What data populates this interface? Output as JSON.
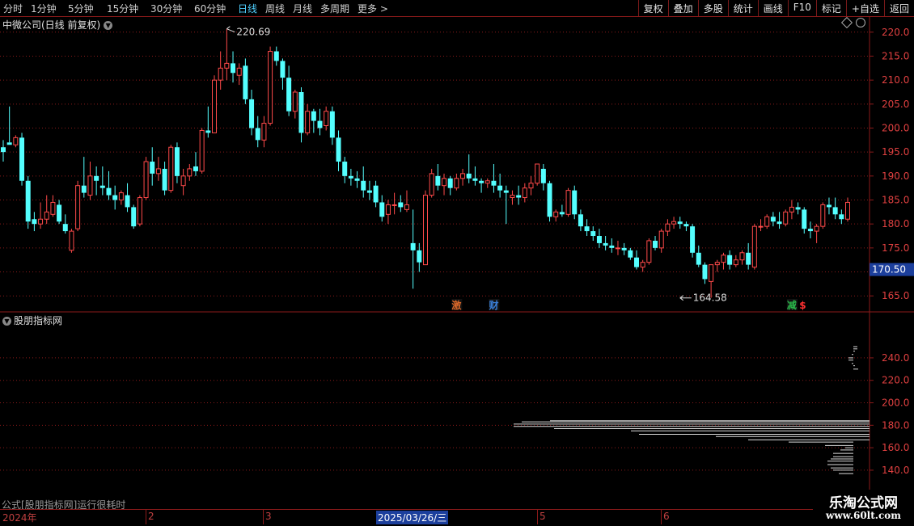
{
  "toolbar": {
    "left_items": [
      "分时",
      "1分钟",
      "5分钟",
      "15分钟",
      "30分钟",
      "60分钟",
      "日线",
      "周线",
      "月线",
      "多周期",
      "更多 >"
    ],
    "active_item": "日线",
    "right_items": [
      "复权",
      "叠加",
      "多股",
      "统计",
      "画线",
      "F10",
      "标记",
      "+自选",
      "返回"
    ]
  },
  "main_pane": {
    "title": "中微公司(日线 前复权)",
    "circle_icon": "chevron-down-icon"
  },
  "indicator_pane": {
    "title": "股朋指标网"
  },
  "status_message": "公式[股朋指标网]运行很耗时",
  "timeline": {
    "labels": [
      "2024年",
      "2",
      "3",
      "5",
      "6"
    ],
    "selected_date": "2025/03/26/三"
  },
  "watermark": {
    "title": "乐淘公式网",
    "url": "www.60lt.com"
  },
  "colors": {
    "up": "#ff4a4a",
    "down": "#54ffff",
    "grid": "#8b1a1a",
    "axis_text": "#e04040",
    "price_box": "#1c3f9c"
  },
  "chart_data": [
    {
      "type": "candlestick",
      "ylim": [
        162,
        223
      ],
      "yticks": [
        "220.0",
        "215.0",
        "210.0",
        "205.0",
        "200.0",
        "195.0",
        "190.0",
        "185.0",
        "180.0",
        "175.0",
        "170.0",
        "165.0"
      ],
      "ytick_values": [
        220,
        215,
        210,
        205,
        200,
        195,
        190,
        185,
        180,
        175,
        170,
        165
      ],
      "annotations": {
        "high": {
          "label": "220.69",
          "value": 220.69,
          "index": 36
        },
        "low": {
          "label": "164.58",
          "value": 164.58,
          "index": 109
        },
        "current_price": {
          "label": "170.50",
          "value": 170.5
        }
      },
      "markers": [
        {
          "label": "激",
          "index": 73,
          "color": "#e06a2a"
        },
        {
          "label": "财",
          "index": 79,
          "color": "#3a7fd8"
        },
        {
          "label": "减",
          "index": 127,
          "color": "#2ab84a"
        },
        {
          "label": "$",
          "index": 129,
          "color": "#ff3030"
        }
      ],
      "candles": [
        [
          196.0,
          197.5,
          195.0,
          193.0
        ],
        [
          197.0,
          204.5,
          196.5,
          197.0
        ],
        [
          196.5,
          198.5,
          198.0,
          196.0
        ],
        [
          198.0,
          199.0,
          189.0,
          188.0
        ],
        [
          189.0,
          190.0,
          180.5,
          179.0
        ],
        [
          181.0,
          182.5,
          180.0,
          178.5
        ],
        [
          180.0,
          184.5,
          181.0,
          179.0
        ],
        [
          181.0,
          186.0,
          182.5,
          180.0
        ],
        [
          182.0,
          186.0,
          184.5,
          181.5
        ],
        [
          184.0,
          185.0,
          180.5,
          180.0
        ],
        [
          180.0,
          182.0,
          178.5,
          178.0
        ],
        [
          174.5,
          179.0,
          178.5,
          174.0
        ],
        [
          179.0,
          189.0,
          188.0,
          178.5
        ],
        [
          188.0,
          194.0,
          186.5,
          185.5
        ],
        [
          186.0,
          193.0,
          190.0,
          185.0
        ],
        [
          190.0,
          192.0,
          189.0,
          186.0
        ],
        [
          188.0,
          192.0,
          187.5,
          186.0
        ],
        [
          187.5,
          191.0,
          186.0,
          185.0
        ],
        [
          186.0,
          188.0,
          185.0,
          183.0
        ],
        [
          185.0,
          187.0,
          186.5,
          184.0
        ],
        [
          186.0,
          188.5,
          183.5,
          182.5
        ],
        [
          183.5,
          184.0,
          179.5,
          179.0
        ],
        [
          180.0,
          186.0,
          185.5,
          179.5
        ],
        [
          185.5,
          194.0,
          193.0,
          185.0
        ],
        [
          193.0,
          196.0,
          190.5,
          188.0
        ],
        [
          190.5,
          194.0,
          191.5,
          189.0
        ],
        [
          191.5,
          193.0,
          187.0,
          186.0
        ],
        [
          187.0,
          196.5,
          196.0,
          186.5
        ],
        [
          196.0,
          197.0,
          190.0,
          188.5
        ],
        [
          188.0,
          191.5,
          190.0,
          186.0
        ],
        [
          190.0,
          192.5,
          191.5,
          189.0
        ],
        [
          192.0,
          195.0,
          191.0,
          190.0
        ],
        [
          191.0,
          200.0,
          199.5,
          190.5
        ],
        [
          199.5,
          204.5,
          199.0,
          198.0
        ],
        [
          199.0,
          211.0,
          210.0,
          199.0
        ],
        [
          210.0,
          216.0,
          212.5,
          208.0
        ],
        [
          212.5,
          220.7,
          213.5,
          210.0
        ],
        [
          213.5,
          216.0,
          211.5,
          209.5
        ],
        [
          211.0,
          213.5,
          212.5,
          209.0
        ],
        [
          213.0,
          214.5,
          206.0,
          205.0
        ],
        [
          206.0,
          208.0,
          200.0,
          198.5
        ],
        [
          200.0,
          202.5,
          197.5,
          196.0
        ],
        [
          197.5,
          202.5,
          201.0,
          196.0
        ],
        [
          201.0,
          217.0,
          216.0,
          200.5
        ],
        [
          216.0,
          217.0,
          214.0,
          213.0
        ],
        [
          214.0,
          214.5,
          210.5,
          208.0
        ],
        [
          210.5,
          213.0,
          203.5,
          202.5
        ],
        [
          203.5,
          208.0,
          207.5,
          202.0
        ],
        [
          207.5,
          208.5,
          199.0,
          197.0
        ],
        [
          199.0,
          205.0,
          203.5,
          198.5
        ],
        [
          203.5,
          204.0,
          201.5,
          199.0
        ],
        [
          201.5,
          204.0,
          200.0,
          198.5
        ],
        [
          200.5,
          204.5,
          203.5,
          199.5
        ],
        [
          203.5,
          204.5,
          198.0,
          196.5
        ],
        [
          198.0,
          199.5,
          193.0,
          191.0
        ],
        [
          193.0,
          194.0,
          190.0,
          188.5
        ],
        [
          190.0,
          191.5,
          189.5,
          188.0
        ],
        [
          189.5,
          191.0,
          189.0,
          187.5
        ],
        [
          189.0,
          192.0,
          187.0,
          185.5
        ],
        [
          187.0,
          189.0,
          186.5,
          185.0
        ],
        [
          188.0,
          189.0,
          184.5,
          183.5
        ],
        [
          184.5,
          186.0,
          181.5,
          180.5
        ],
        [
          182.0,
          185.0,
          184.0,
          180.0
        ],
        [
          184.0,
          186.5,
          184.0,
          182.0
        ],
        [
          184.5,
          186.0,
          183.5,
          182.5
        ],
        [
          183.0,
          187.0,
          184.0,
          182.5
        ],
        [
          176.0,
          183.0,
          174.5,
          166.5
        ],
        [
          174.5,
          176.0,
          172.0,
          170.0
        ],
        [
          171.5,
          187.0,
          186.0,
          171.5
        ],
        [
          186.0,
          191.5,
          190.5,
          185.5
        ],
        [
          190.0,
          192.5,
          188.0,
          187.0
        ],
        [
          188.0,
          190.5,
          189.5,
          186.0
        ],
        [
          189.5,
          190.0,
          187.5,
          186.0
        ],
        [
          187.5,
          190.5,
          189.5,
          187.0
        ],
        [
          189.5,
          191.5,
          190.5,
          188.0
        ],
        [
          190.5,
          194.5,
          189.5,
          188.5
        ],
        [
          189.5,
          192.0,
          189.0,
          188.0
        ],
        [
          189.0,
          189.5,
          188.5,
          186.5
        ],
        [
          188.5,
          189.5,
          189.0,
          187.5
        ],
        [
          189.0,
          192.5,
          188.0,
          186.5
        ],
        [
          188.0,
          190.5,
          187.0,
          185.5
        ],
        [
          187.0,
          188.0,
          186.5,
          180.0
        ],
        [
          185.5,
          187.0,
          186.0,
          184.0
        ],
        [
          186.0,
          188.0,
          185.5,
          184.0
        ],
        [
          185.5,
          188.5,
          187.5,
          184.5
        ],
        [
          187.5,
          190.0,
          188.5,
          186.0
        ],
        [
          188.5,
          192.0,
          192.5,
          188.0
        ],
        [
          191.5,
          192.5,
          188.5,
          187.0
        ],
        [
          188.5,
          189.0,
          181.5,
          180.5
        ],
        [
          181.5,
          183.0,
          182.5,
          180.5
        ],
        [
          182.5,
          184.0,
          182.0,
          181.5
        ],
        [
          182.0,
          187.5,
          187.0,
          181.5
        ],
        [
          187.0,
          188.0,
          182.0,
          181.0
        ],
        [
          182.0,
          183.0,
          179.5,
          178.5
        ],
        [
          179.5,
          181.0,
          178.5,
          177.5
        ],
        [
          178.5,
          179.5,
          177.5,
          176.5
        ],
        [
          177.5,
          179.0,
          176.0,
          175.0
        ],
        [
          176.0,
          177.5,
          175.5,
          174.5
        ],
        [
          175.5,
          177.0,
          175.0,
          174.0
        ],
        [
          175.0,
          176.5,
          175.0,
          173.5
        ],
        [
          175.0,
          176.0,
          174.5,
          173.5
        ],
        [
          174.5,
          175.0,
          173.0,
          172.5
        ],
        [
          173.0,
          174.5,
          171.0,
          170.5
        ],
        [
          171.0,
          172.5,
          172.0,
          170.0
        ],
        [
          172.0,
          177.0,
          176.5,
          171.5
        ],
        [
          176.5,
          177.5,
          175.0,
          174.5
        ],
        [
          175.0,
          179.0,
          178.5,
          174.0
        ],
        [
          178.5,
          181.0,
          180.0,
          177.5
        ],
        [
          180.0,
          181.5,
          180.5,
          179.0
        ],
        [
          180.5,
          181.5,
          180.0,
          179.0
        ],
        [
          180.0,
          180.5,
          179.5,
          178.5
        ],
        [
          179.5,
          180.0,
          174.0,
          173.0
        ],
        [
          174.0,
          175.5,
          171.5,
          171.0
        ],
        [
          171.5,
          172.0,
          168.5,
          167.5
        ],
        [
          168.0,
          171.5,
          171.5,
          164.6
        ],
        [
          171.5,
          172.5,
          172.0,
          170.0
        ],
        [
          172.0,
          174.0,
          173.5,
          170.5
        ],
        [
          173.5,
          174.5,
          171.5,
          170.5
        ],
        [
          171.5,
          173.5,
          172.5,
          171.0
        ],
        [
          172.5,
          174.5,
          174.0,
          171.5
        ],
        [
          174.0,
          176.0,
          171.5,
          170.5
        ],
        [
          171.0,
          180.0,
          179.5,
          170.5
        ],
        [
          179.5,
          181.0,
          179.5,
          178.5
        ],
        [
          179.5,
          182.0,
          181.5,
          179.0
        ],
        [
          181.5,
          182.5,
          180.5,
          179.5
        ],
        [
          180.5,
          182.5,
          180.0,
          179.0
        ],
        [
          180.0,
          183.0,
          182.5,
          179.5
        ],
        [
          182.5,
          185.0,
          183.5,
          181.0
        ],
        [
          183.5,
          184.5,
          183.0,
          182.0
        ],
        [
          183.0,
          183.5,
          179.0,
          178.0
        ],
        [
          179.0,
          180.5,
          178.5,
          177.0
        ],
        [
          178.5,
          180.0,
          179.5,
          176.0
        ],
        [
          179.5,
          184.5,
          184.0,
          179.0
        ],
        [
          184.0,
          185.5,
          183.5,
          182.0
        ],
        [
          183.5,
          185.5,
          182.0,
          181.0
        ],
        [
          182.0,
          183.0,
          181.0,
          180.0
        ],
        [
          181.0,
          185.5,
          184.5,
          180.5
        ]
      ]
    },
    {
      "type": "bar",
      "orientation": "horizontal",
      "ylim": [
        127,
        268
      ],
      "yticks": [
        "240.0",
        "220.0",
        "200.0",
        "180.0",
        "160.0",
        "140.0"
      ],
      "ytick_values": [
        240,
        220,
        200,
        180,
        160,
        140
      ],
      "values_y": [
        250,
        248,
        246,
        243,
        240,
        238,
        235,
        233,
        230,
        184,
        183,
        181,
        179,
        177,
        175,
        172,
        170,
        167,
        165,
        162,
        160,
        158,
        155,
        152,
        150,
        148,
        145,
        142,
        140,
        137
      ],
      "values_len": [
        15,
        15,
        18,
        22,
        26,
        26,
        22,
        18,
        14,
        395,
        430,
        440,
        440,
        390,
        295,
        285,
        190,
        150,
        100,
        55,
        30,
        36,
        45,
        45,
        48,
        52,
        52,
        48,
        45,
        38
      ]
    }
  ]
}
